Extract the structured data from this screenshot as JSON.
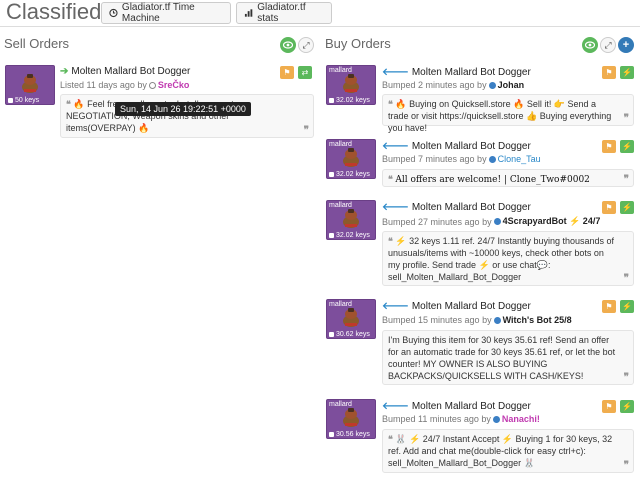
{
  "header": {
    "title": "Classifieds",
    "time_machine_label": "Gladiator.tf Time Machine",
    "stats_label": "Gladiator.tf stats"
  },
  "sell": {
    "title": "Sell Orders",
    "listings": [
      {
        "paint": "",
        "price_tag": "50 keys",
        "item": "Molten Mallard Bot Dogger",
        "meta_prefix": "Listed 11 days ago by",
        "user": "SreČko",
        "quote": "🔥 Feel free ... , I'm not a bot, I'm open to NEGOTIATION, Weapon skins and other items(OVERPAY) 🔥"
      }
    ],
    "tooltip": "Sun, 14 Jun 26 19:22:51 +0000"
  },
  "buy": {
    "title": "Buy Orders",
    "listings": [
      {
        "paint": "mallard",
        "price_tag": "32.02 keys",
        "item": "Molten Mallard Bot Dogger",
        "meta_prefix": "Bumped 2 minutes ago by",
        "user": "Johan",
        "quote": "🔥 Buying on Quicksell.store 🔥 Sell it! 👉 Send a trade or visit https://quicksell.store 👍 Buying everything you have!"
      },
      {
        "paint": "mallard",
        "price_tag": "32.02 keys",
        "item": "Molten Mallard Bot Dogger",
        "meta_prefix": "Bumped 7 minutes ago by",
        "user": "Clone_Tau",
        "quote": "All offers are welcome! | Clone_Two#0002"
      },
      {
        "paint": "mallard",
        "price_tag": "32.02 keys",
        "item": "Molten Mallard Bot Dogger",
        "meta_prefix": "Bumped 27 minutes ago by",
        "user": "4ScrapyardBot ⚡ 24/7",
        "quote": "⚡ 32 keys 1.11 ref. 24/7 Instantly buying thousands of unusuals/items with ~10000 keys, check other bots on my profile. Send trade ⚡ or use chat💬: sell_Molten_Mallard_Bot_Dogger"
      },
      {
        "paint": "mallard",
        "price_tag": "30.62 keys",
        "item": "Molten Mallard Bot Dogger",
        "meta_prefix": "Bumped 15 minutes ago by",
        "user": "Witch's Bot 25/8",
        "quote": "I'm Buying this item for 30 keys 35.61 ref! Send an offer for an automatic trade for 30 keys 35.61 ref, or let the bot counter! MY OWNER IS ALSO BUYING BACKPACKS/QUICKSELLS WITH CASH/KEYS!"
      },
      {
        "paint": "mallard",
        "price_tag": "30.56 keys",
        "item": "Molten Mallard Bot Dogger",
        "meta_prefix": "Bumped 11 minutes ago by",
        "user": "Nanachi!",
        "quote": "🐰 ⚡ 24/7 Instant Accept ⚡ Buying 1 for 30 keys, 32 ref. Add and chat me(double-click for easy ctrl+c): sell_Molten_Mallard_Bot_Dogger 🐰"
      }
    ]
  },
  "colors": {
    "accent_green": "#5cb85c",
    "accent_orange": "#f0ad4e",
    "accent_blue": "#337ab7",
    "thumb_purple": "#7d4e9c"
  }
}
